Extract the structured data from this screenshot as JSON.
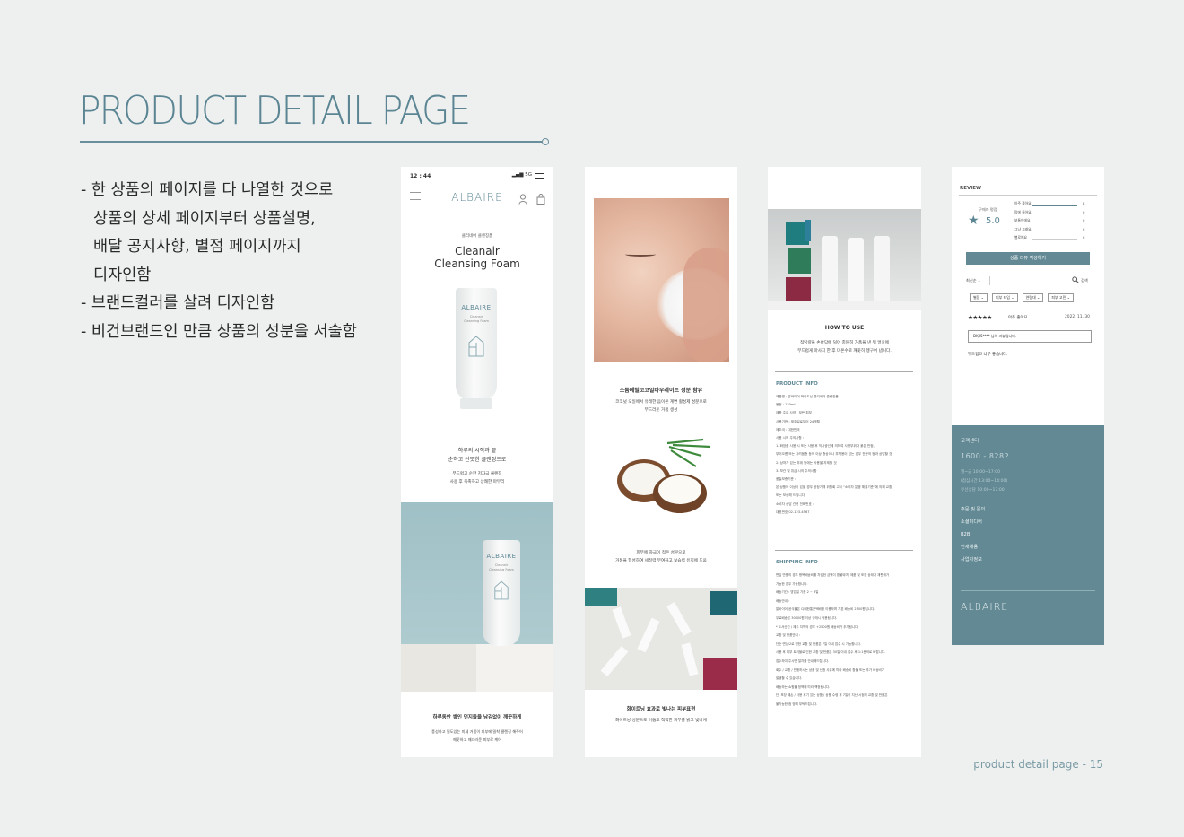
{
  "slide": {
    "title": "PRODUCT DETAIL PAGE",
    "page_number": "product detail page - 15",
    "description": [
      {
        "text": "- 한 상품의 페이지를 다 나열한 것으로",
        "indent": false
      },
      {
        "text": "상품의 상세 페이지부터 상품설명,",
        "indent": true
      },
      {
        "text": "배달 공지사항, 별점 페이지까지",
        "indent": true
      },
      {
        "text": "디자인함",
        "indent": true
      },
      {
        "text": "- 브랜드컬러를 살려 디자인함",
        "indent": false
      },
      {
        "text": "- 비건브랜드인 만큼 상품의 성분을 서술함",
        "indent": false
      }
    ],
    "colors": {
      "brand": "#5b8593",
      "footer": "#628994",
      "background": "#eef0f0"
    }
  },
  "panel1": {
    "status_time": "12 : 44",
    "status_signal": "5G",
    "brand_logo": "ALBAIRE",
    "category": "클리네어 클렌징폼",
    "product_name_line1": "Cleanair",
    "product_name_line2": "Cleansing Foam",
    "tube_brand": "ALBAIRE",
    "tube_sub1": "Cleanair",
    "tube_sub2": "Cleansing Foam",
    "copy_head1": "하루의 시작과 끝",
    "copy_head2": "순하고 산뜻한 클렌징으로",
    "copy_body1": "부드럽고 순한 저자극 클렌징",
    "copy_body2": "사용 후 촉촉하고 상쾌한 마무리",
    "bottom_head": "하루동안 쌓인 먼지들을 남김없이 깨끗하게",
    "bottom_body1": "풍성하고 필도있는 미세 거품이 피부에 밀착 클렌징 해주어",
    "bottom_body2": "깨끗하고 매끄러운 피부로 케어"
  },
  "panel2": {
    "ingredient_head": "소듐메틸코코일타우레이트 성분 함유",
    "ingredient_body1": "코코넛 오일에서 유래한 음이온 계면 활성제 성분으로",
    "ingredient_body2": "부드러운 거품 생성",
    "coconut_body1": "피부에 자극이 적은 성분으로",
    "coconut_body2": "거품을 형성하여 세정력 부여하고 보습력 유지에 도움",
    "whitening_head": "화이트닝 효과로 빛나는 피부표현",
    "whitening_body": "화이트닝 성분으로 어둡고 칙칙한 피부를 밝고 빛나게"
  },
  "panel3": {
    "how_to_use": "HOW TO USE",
    "how_body1": "적당량을 손바닥에 덜어 충분히 거품을 낸 뒤 얼굴에",
    "how_body2": "부드럽게 마사지 한 후 미온수로 깨끗히 헹구어 냅니다.",
    "product_info": "PRODUCT INFO",
    "info_lines": [
      "제품명 : 알바이어 화이트닝 클리네어 클렌징폼",
      "용량 : 120ml",
      "제품 주요 사양 : 모든 피부",
      "사용기한 : 제조일로부터 24개월",
      "제조국 : 대한민국",
      "사용 시의 주의사항 :",
      "1. 화장품 사용 시 또는 사용 후 직사광선에 의하여 사용부위가 붉은 반점,",
      "부어오름 또는 가려움증 등의 이상 증상이나 부작용이 있는 경우 전문의 등과 상담할 것",
      "2. 상처가 있는 부위 등에는 사용을 자제할 것",
      "3. 보관 및 취급 시의 주의사항",
      "품질보증기준 :",
      "본 상품에 이상이 있을 경우 공정거래 위원회 고시 \"소비자 분쟁 해결기준\"에 의해 교환",
      "또는 보상해 드립니다.",
      "소비자 상담 관련 전화번호 :",
      "대표번호 02-123-4567"
    ],
    "shipping_info": "SHIPPING INFO",
    "ship_lines": [
      "변심 반품의 경우 왕복배송비를 차감한 금액이 환불되며, 제품 및 포장 상태가 재판매가",
      "가능한 경우 가능합니다.",
      "배송기간 : 영업일 기준 2 ~ 3일",
      "배송안내 :",
      "알바이어 공식몰은 CJ대한통운택배를 이용하며 기본 배송비 2500원입니다.",
      "무료배송은 30000원 이상 구매시 적용됩니다.",
      "* 도서산간 / 제주 지역의 경우 +2500원 배송비가 추가됩니다.",
      "교환 및 반품안내 :",
      "단순 변심으로 인한 교환 및 반품은 7일 이내 접수 시 가능합니다.",
      "사용 후 피부 트러블로 인한 교환 및 반품은 30일 이내 접수 후 1:1문의로 바랍니다.",
      "접수하여 주시면 절차를 안내해드립니다.",
      "회수 / 교환 / 반품하시는 상품 및 신청 사유에 따라 배송비 환불 또는 추가 배송비가",
      "발생할 수 있습니다.",
      "배송하는 쇼핑몰 정책에 따라 책정됩니다.",
      "단, 포장 훼손 / 사용 후기 있는 상품 / 상품 수령 후 7일이 지난 시점의 교환 및 반품은",
      "불가능한 점 양해 부탁드립니다."
    ]
  },
  "panel4": {
    "review_label": "REVIEW",
    "rating_caption": "구매자 평점",
    "rating_value": "5.0",
    "rating_rows": [
      {
        "label": "아주 좋아요",
        "count": "8",
        "fraction": 1.0
      },
      {
        "label": "맘에 들어요",
        "count": "0",
        "fraction": 0
      },
      {
        "label": "보통이에요",
        "count": "0",
        "fraction": 0
      },
      {
        "label": "그냥 그래요",
        "count": "0",
        "fraction": 0
      },
      {
        "label": "별로예요",
        "count": "0",
        "fraction": 0
      }
    ],
    "write_review_button": "상품 리뷰 작성하기",
    "sort_label": "최신순",
    "search_label": "검색",
    "filters": [
      "별점",
      "피부 타입",
      "연령대",
      "피부 고민"
    ],
    "review_stars": "★★★★★",
    "review_rating_text": "아주 좋아요",
    "review_date": "2022. 11. 30",
    "review_user": "DKJI5****  님의 리뷰입니다.",
    "review_text": "부드럽고 너무 좋습니다.",
    "footer": {
      "cs_label": "고객센터",
      "phone": "1600 - 8282",
      "hours1": "월~금 10:00~17:00",
      "hours2": "(점심시간 13:00~14:00)",
      "hours3": "유선상담 10:00~17:00",
      "links": [
        "주문 및 문의",
        "소셜미디어",
        "B2B",
        "인재채용",
        "사업자정보"
      ],
      "brand_logo": "ALBAIRE"
    }
  }
}
